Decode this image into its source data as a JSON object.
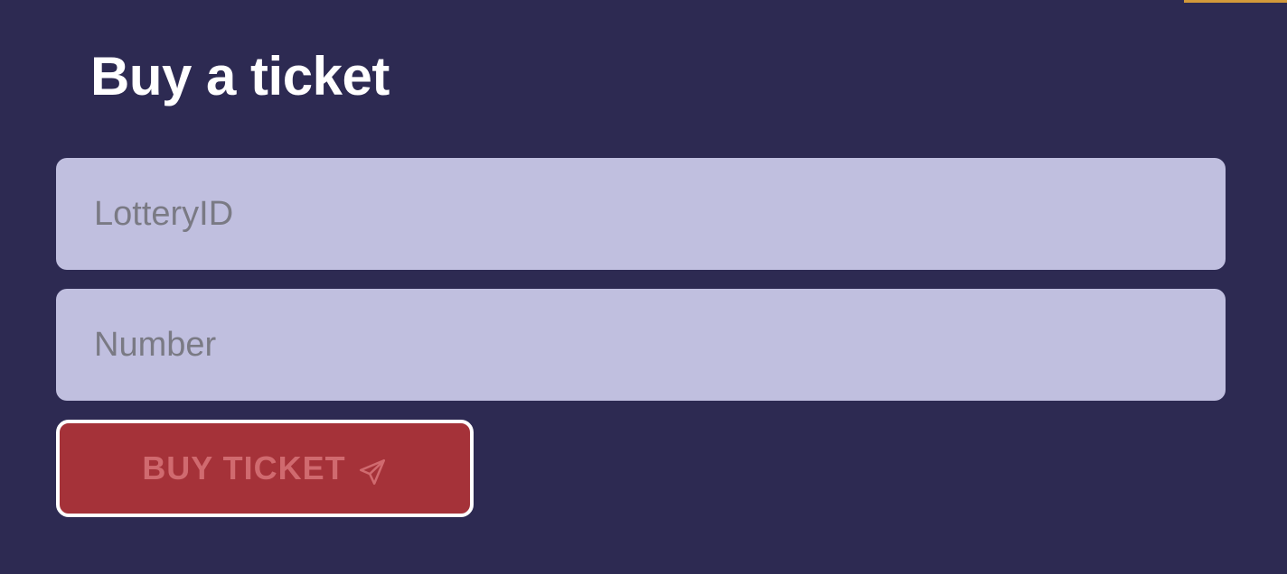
{
  "form": {
    "title": "Buy a ticket",
    "lottery_id": {
      "placeholder": "LotteryID",
      "value": ""
    },
    "number": {
      "placeholder": "Number",
      "value": ""
    },
    "submit_label": "BUY TICKET",
    "submit_icon": "send-icon"
  },
  "colors": {
    "background": "#2d2a52",
    "input_background": "#c0bfdf",
    "button_background": "#a53239",
    "button_text": "#d06a6f",
    "accent": "#d39a3a"
  }
}
